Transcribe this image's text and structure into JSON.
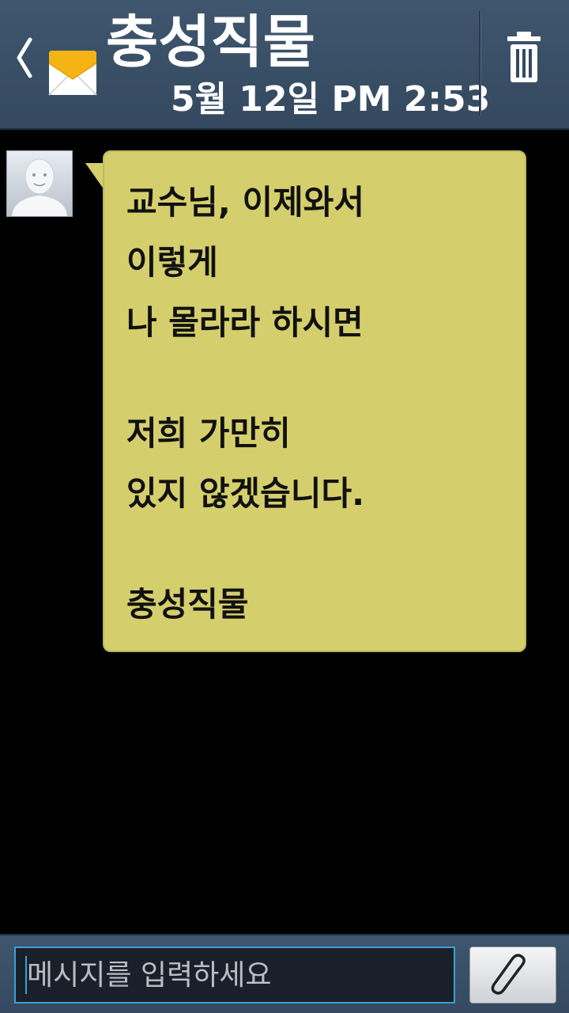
{
  "header": {
    "contact_name": "충성직물",
    "timestamp": "5월 12일 PM 2:53",
    "back_icon": "chevron-left-icon",
    "message_icon": "envelope-icon",
    "delete_icon": "trash-icon"
  },
  "message": {
    "lines": [
      "교수님, 이제와서",
      "이렇게",
      "나 몰라라 하시면",
      "",
      "저희 가만히",
      "있지 않겠습니다.",
      "",
      "충성직물"
    ],
    "bubble_color": "#d4cf6c",
    "avatar_icon": "default-person-icon"
  },
  "composer": {
    "placeholder": "메시지를 입력하세요",
    "attach_icon": "paperclip-icon",
    "focus_color": "#3aa0d8"
  },
  "colors": {
    "header_bg": "#3a4f66",
    "background": "#000000"
  }
}
